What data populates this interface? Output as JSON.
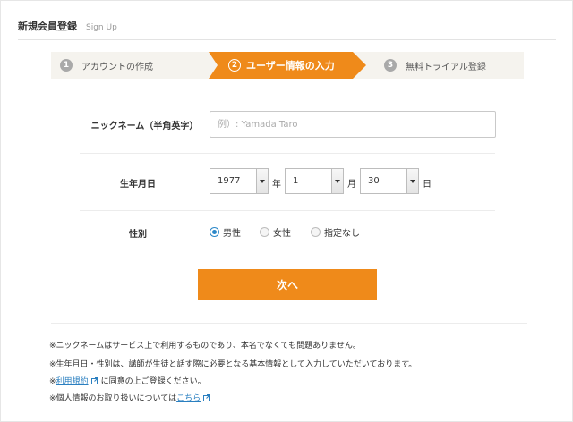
{
  "header": {
    "title": "新規会員登録",
    "subtitle": "Sign Up"
  },
  "steps": [
    {
      "num": "1",
      "label": "アカウントの作成"
    },
    {
      "num": "2",
      "label": "ユーザー情報の入力"
    },
    {
      "num": "3",
      "label": "無料トライアル登録"
    }
  ],
  "form": {
    "nickname": {
      "label": "ニックネーム（半角英字）",
      "placeholder": "例）: Yamada Taro",
      "value": ""
    },
    "birthdate": {
      "label": "生年月日",
      "year": "1977",
      "year_unit": "年",
      "month": "1",
      "month_unit": "月",
      "day": "30",
      "day_unit": "日"
    },
    "gender": {
      "label": "性別",
      "options": [
        "男性",
        "女性",
        "指定なし"
      ],
      "selected": "男性"
    },
    "next_label": "次へ"
  },
  "notes": {
    "n1": "※ニックネームはサービス上で利用するものであり、本名でなくても問題ありません。",
    "n2": "※生年月日・性別は、講師が生徒と話す際に必要となる基本情報として入力していただいております。",
    "n3_prefix": "※",
    "n3_link": "利用規約",
    "n3_suffix": "に同意の上ご登録ください。",
    "n4_prefix": "※個人情報のお取り扱いについては",
    "n4_link": "こちら"
  },
  "colors": {
    "accent": "#ef8a1a",
    "link": "#2a7fc0",
    "radio": "#2a87c8"
  }
}
